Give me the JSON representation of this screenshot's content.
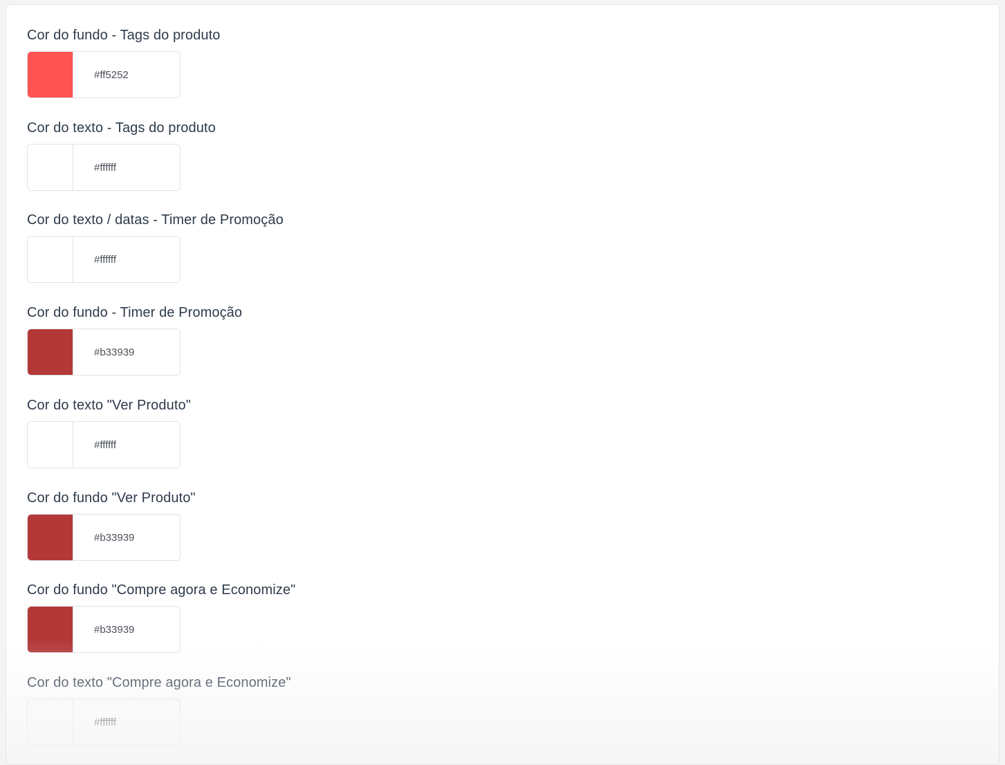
{
  "fields": [
    {
      "label": "Cor do fundo - Tags do produto",
      "hex": "#ff5252",
      "color": "#ff5252"
    },
    {
      "label": "Cor do texto - Tags do produto",
      "hex": "#ffffff",
      "color": "#ffffff"
    },
    {
      "label": "Cor do texto / datas - Timer de Promoção",
      "hex": "#ffffff",
      "color": "#ffffff"
    },
    {
      "label": "Cor do fundo - Timer de Promoção",
      "hex": "#b33939",
      "color": "#b33939"
    },
    {
      "label": "Cor do texto \"Ver Produto\"",
      "hex": "#ffffff",
      "color": "#ffffff"
    },
    {
      "label": "Cor do fundo \"Ver Produto\"",
      "hex": "#b33939",
      "color": "#b33939"
    },
    {
      "label": "Cor do fundo \"Compre agora e Economize\"",
      "hex": "#b33939",
      "color": "#b33939"
    },
    {
      "label": "Cor do texto \"Compre agora e Economize\"",
      "hex": "#ffffff",
      "color": "#ffffff"
    }
  ]
}
